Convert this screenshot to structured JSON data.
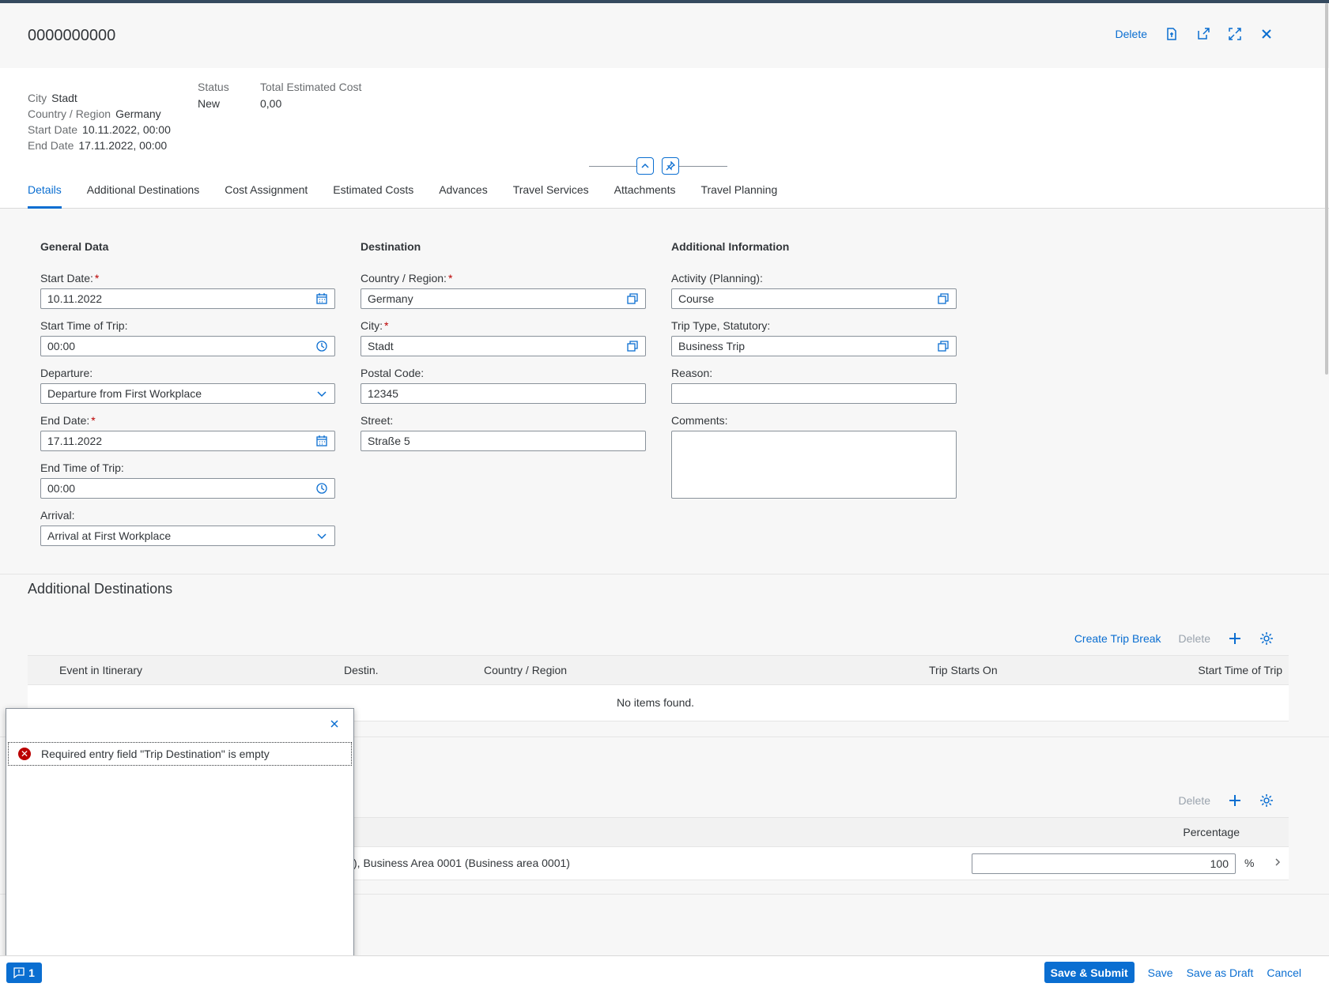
{
  "header": {
    "title": "0000000000",
    "delete_label": "Delete"
  },
  "object_header": {
    "attributes": [
      {
        "key": "City",
        "value": "Stadt"
      },
      {
        "key": "Country / Region",
        "value": "Germany"
      },
      {
        "key": "Start Date",
        "value": "10.11.2022, 00:00"
      },
      {
        "key": "End Date",
        "value": "17.11.2022, 00:00"
      }
    ],
    "status": {
      "key": "Status",
      "value": "New"
    },
    "total": {
      "key": "Total Estimated Cost",
      "value": "0,00"
    }
  },
  "tabs": [
    "Details",
    "Additional Destinations",
    "Cost Assignment",
    "Estimated Costs",
    "Advances",
    "Travel Services",
    "Attachments",
    "Travel Planning"
  ],
  "general": {
    "title": "General Data",
    "start_date_label": "Start Date:",
    "start_date": "10.11.2022",
    "start_time_label": "Start Time of Trip:",
    "start_time": "00:00",
    "departure_label": "Departure:",
    "departure": "Departure from First Workplace",
    "end_date_label": "End Date:",
    "end_date": "17.11.2022",
    "end_time_label": "End Time of Trip:",
    "end_time": "00:00",
    "arrival_label": "Arrival:",
    "arrival": "Arrival at First Workplace"
  },
  "destination": {
    "title": "Destination",
    "country_label": "Country / Region:",
    "country": "Germany",
    "city_label": "City:",
    "city": "Stadt",
    "postal_label": "Postal Code:",
    "postal": "12345",
    "street_label": "Street:",
    "street": "Straße 5"
  },
  "additional_info": {
    "title": "Additional Information",
    "activity_label": "Activity (Planning):",
    "activity": "Course",
    "trip_type_label": "Trip Type, Statutory:",
    "trip_type": "Business Trip",
    "reason_label": "Reason:",
    "reason": "",
    "comments_label": "Comments:"
  },
  "additional_destinations": {
    "title": "Additional Destinations",
    "create_break": "Create Trip Break",
    "delete": "Delete",
    "columns": [
      "Event in Itinerary",
      "Destin.",
      "Country / Region",
      "Trip Starts On",
      "Start Time of Trip"
    ],
    "empty": "No items found."
  },
  "cost_assignment": {
    "delete": "Delete",
    "column": "Percentage",
    "row_text": "), Business Area 0001 (Business area 0001)",
    "percentage": "100",
    "unit": "%"
  },
  "message_popover": {
    "message": "Required entry field \"Trip Destination\" is empty"
  },
  "footer": {
    "message_count": "1",
    "save_submit": "Save & Submit",
    "save": "Save",
    "save_draft": "Save as Draft",
    "cancel": "Cancel"
  }
}
